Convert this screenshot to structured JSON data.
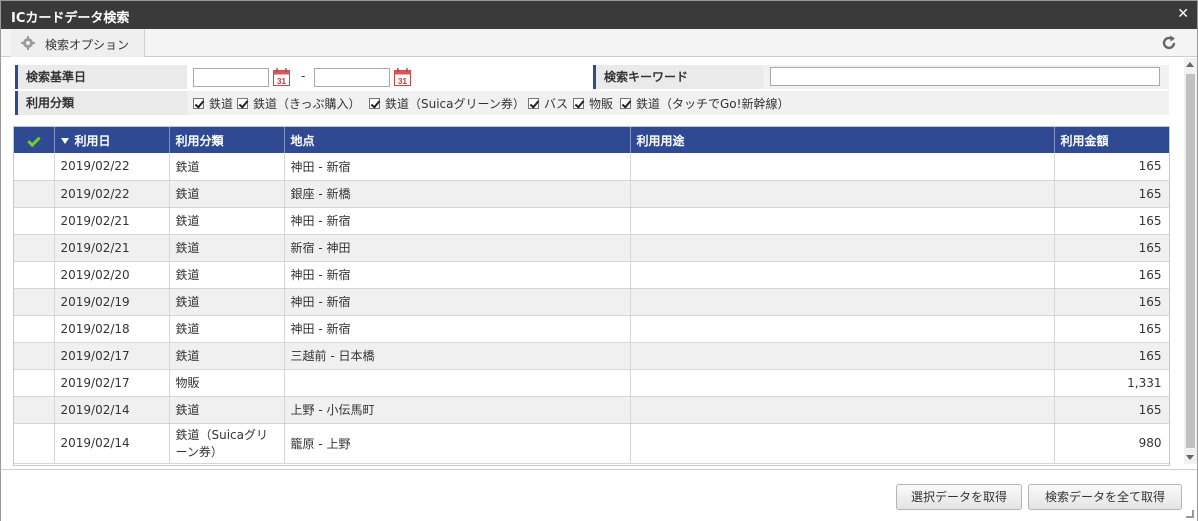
{
  "window": {
    "title": "ICカードデータ検索"
  },
  "options": {
    "tab_label": "検索オプション"
  },
  "form": {
    "base_date_label": "検索基準日",
    "date_from": "",
    "date_separator": "-",
    "date_to": "",
    "keyword_label": "検索キーワード",
    "keyword_value": "",
    "usage_type_label": "利用分類",
    "usage_types": [
      {
        "label": "鉄道",
        "checked": true
      },
      {
        "label": "鉄道（きっぷ購入）",
        "checked": true
      },
      {
        "label": "鉄道（Suicaグリーン券）",
        "checked": true
      },
      {
        "label": "バス",
        "checked": true
      },
      {
        "label": "物販",
        "checked": true
      },
      {
        "label": "鉄道（タッチでGo!新幹線）",
        "checked": true
      }
    ]
  },
  "table": {
    "headers": [
      "",
      "利用日",
      "利用分類",
      "地点",
      "利用用途",
      "利用金額"
    ],
    "rows": [
      {
        "date": "2019/02/22",
        "type": "鉄道",
        "location": "神田 - 新宿",
        "purpose": "",
        "amount": "165"
      },
      {
        "date": "2019/02/22",
        "type": "鉄道",
        "location": "銀座 - 新橋",
        "purpose": "",
        "amount": "165"
      },
      {
        "date": "2019/02/21",
        "type": "鉄道",
        "location": "神田 - 新宿",
        "purpose": "",
        "amount": "165"
      },
      {
        "date": "2019/02/21",
        "type": "鉄道",
        "location": "新宿 - 神田",
        "purpose": "",
        "amount": "165"
      },
      {
        "date": "2019/02/20",
        "type": "鉄道",
        "location": "神田 - 新宿",
        "purpose": "",
        "amount": "165"
      },
      {
        "date": "2019/02/19",
        "type": "鉄道",
        "location": "神田 - 新宿",
        "purpose": "",
        "amount": "165"
      },
      {
        "date": "2019/02/18",
        "type": "鉄道",
        "location": "神田 - 新宿",
        "purpose": "",
        "amount": "165"
      },
      {
        "date": "2019/02/17",
        "type": "鉄道",
        "location": "三越前 - 日本橋",
        "purpose": "",
        "amount": "165"
      },
      {
        "date": "2019/02/17",
        "type": "物販",
        "location": "",
        "purpose": "",
        "amount": "1,331"
      },
      {
        "date": "2019/02/14",
        "type": "鉄道",
        "location": "上野 - 小伝馬町",
        "purpose": "",
        "amount": "165"
      },
      {
        "date": "2019/02/14",
        "type": "鉄道（Suicaグリーン券）",
        "location": "籠原 - 上野",
        "purpose": "",
        "amount": "980"
      }
    ]
  },
  "footer": {
    "get_selected_label": "選択データを取得",
    "get_all_label": "検索データを全て取得"
  },
  "icons": {
    "close": "close-icon",
    "gear": "gear-icon",
    "refresh": "refresh-icon",
    "calendar": "calendar-icon",
    "select_all": "check-icon",
    "sort_desc": "sort-desc-icon"
  },
  "colors": {
    "titlebar": "#3a3a3a",
    "header_bg": "#2f4a93",
    "check_green": "#6fcf2a"
  }
}
